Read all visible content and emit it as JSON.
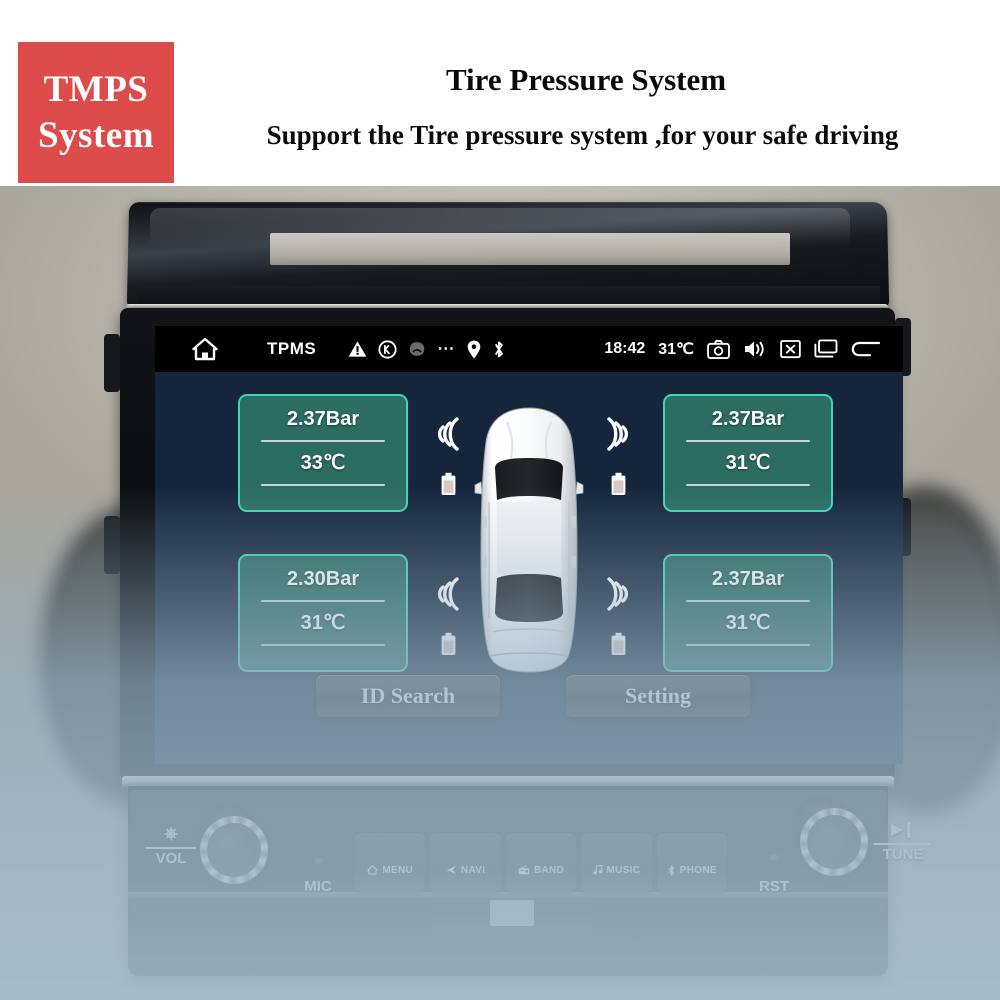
{
  "banner": {
    "logo_line1": "TMPS",
    "logo_line2": "System",
    "logo_color": "#dd4b4b",
    "title": "Tire Pressure System",
    "subtitle": "Support the Tire pressure system ,for your safe driving"
  },
  "head_unit": {
    "screen": {
      "background_color": "#15263c",
      "statusbar": {
        "background_color": "#000000",
        "home_icon": "home-icon",
        "app_name": "TPMS",
        "icons": [
          "warning-triangle-icon",
          "circled-k-icon",
          "car-seat-icon",
          "more-dots-icon",
          "location-pin-icon",
          "bluetooth-icon"
        ],
        "time": "18:42",
        "temperature": "31℃",
        "camera_icon": "camera-icon",
        "volume_icon": "volume-icon",
        "close_icon": "close-box-icon",
        "recents_icon": "recents-icon",
        "back_icon": "back-arrow-icon"
      },
      "tires": [
        {
          "position": "front-left",
          "pressure": "2.37Bar",
          "temperature": "33℃",
          "signal": "signal-waves-icon",
          "battery": "battery-icon"
        },
        {
          "position": "front-right",
          "pressure": "2.37Bar",
          "temperature": "31℃",
          "signal": "signal-waves-icon",
          "battery": "battery-icon"
        },
        {
          "position": "rear-left",
          "pressure": "2.30Bar",
          "temperature": "31℃",
          "signal": "signal-waves-icon",
          "battery": "battery-icon"
        },
        {
          "position": "rear-right",
          "pressure": "2.37Bar",
          "temperature": "31℃",
          "signal": "signal-waves-icon",
          "battery": "battery-icon"
        }
      ],
      "card_colors": {
        "fill": "#2b6c63",
        "border": "#3fd6b8",
        "text": "#ffffff"
      },
      "vehicle_graphic": "car-top-view-icon",
      "buttons": {
        "id_search": "ID Search",
        "setting": "Setting"
      }
    },
    "panel": {
      "vol_label": "VOL",
      "power_icon": "power-icon",
      "mic_label": "MIC",
      "rst_label": "RST",
      "tune_label": "TUNE",
      "play_pause_icon": "play-pause-icon",
      "buttons": [
        {
          "label": "MENU",
          "icon": "home-icon"
        },
        {
          "label": "NAVI",
          "icon": "navigation-arrow-icon"
        },
        {
          "label": "BAND",
          "icon": "radio-icon"
        },
        {
          "label": "MUSIC",
          "icon": "music-note-icon"
        },
        {
          "label": "PHONE",
          "icon": "bluetooth-icon"
        }
      ]
    }
  }
}
